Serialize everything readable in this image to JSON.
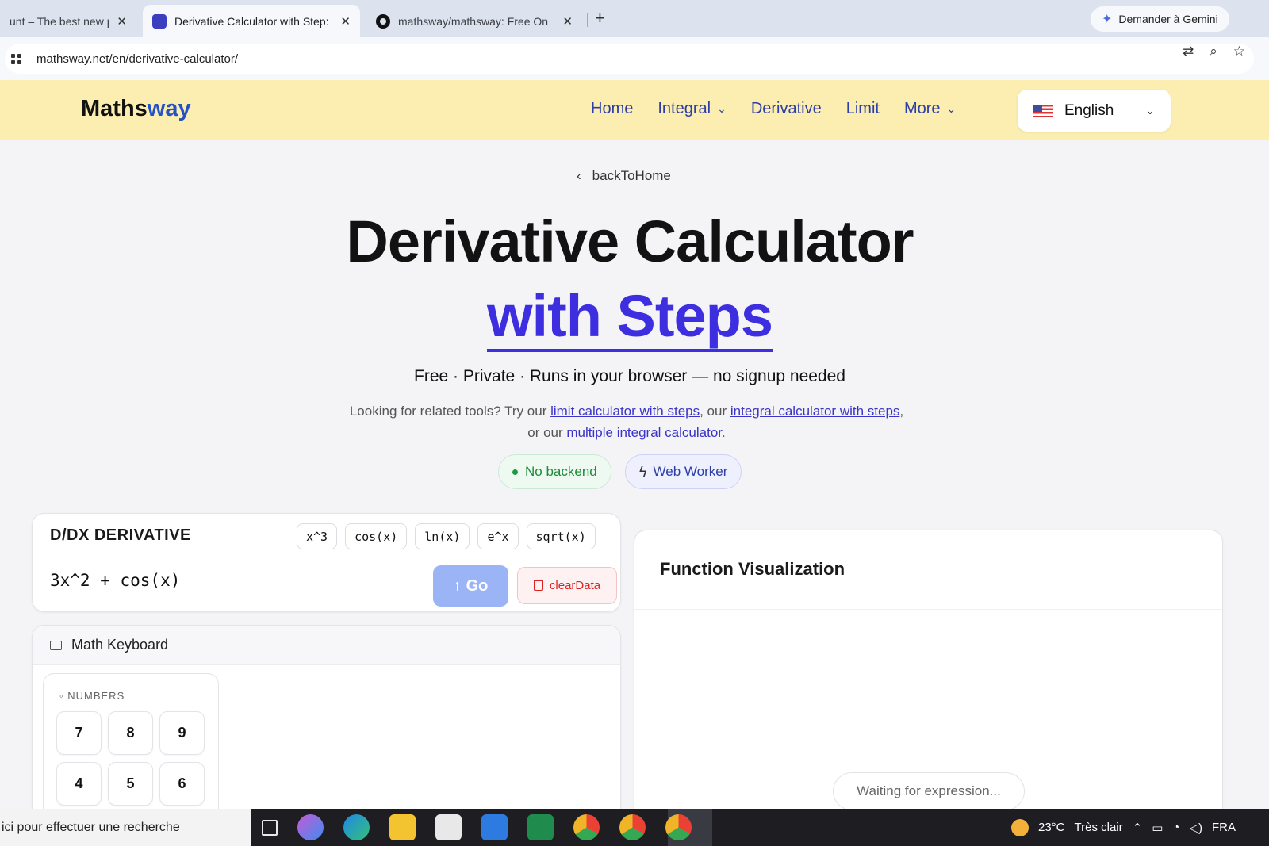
{
  "browser": {
    "tabs": [
      {
        "title": "unt – The best new p",
        "active": false
      },
      {
        "title": "Derivative Calculator with Step:",
        "active": true
      },
      {
        "title": "mathsway/mathsway: Free On",
        "active": false
      }
    ],
    "new_tab": "+",
    "close_glyph": "✕",
    "gemini_label": "Demander à Gemini",
    "url": "mathsway.net/en/derivative-calculator/",
    "address_icons": [
      "translate-icon",
      "zoom-icon",
      "bookmark-star-icon"
    ]
  },
  "site": {
    "logo_main": "Maths",
    "logo_accent": "way",
    "nav": {
      "home": "Home",
      "integral": "Integral",
      "derivative": "Derivative",
      "limit": "Limit",
      "more": "More"
    },
    "language": "English"
  },
  "hero": {
    "back_link": "backToHome",
    "title": "Derivative Calculator",
    "subtitle": "with Steps",
    "tagline": "Free · Private · Runs in your browser — no signup needed",
    "related_prefix": "Looking for related tools? Try our ",
    "related_link1": "limit calculator with steps",
    "related_mid1": ", our ",
    "related_link2": "integral calculator with steps",
    "related_mid2": ", or our ",
    "related_link3": "multiple integral calculator",
    "related_suffix": ".",
    "badge_backend": "No backend",
    "badge_worker": "Web Worker"
  },
  "calculator": {
    "title": "D/DX DERIVATIVE",
    "chips": [
      "x^3",
      "cos(x)",
      "ln(x)",
      "e^x",
      "sqrt(x)"
    ],
    "expression": "3x^2 + cos(x)",
    "go_label": "Go",
    "clear_label": "clearData"
  },
  "keyboard": {
    "title": "Math Keyboard",
    "section_label": "NUMBERS",
    "keys": [
      "7",
      "8",
      "9",
      "4",
      "5",
      "6"
    ]
  },
  "visualization": {
    "title": "Function Visualization",
    "status": "Waiting for expression..."
  },
  "taskbar": {
    "search_text": "ici pour effectuer une recherche",
    "temperature": "23°C",
    "weather": "Très clair",
    "language": "FRA",
    "app_colors": [
      "#e8e8e8",
      "#c45bd6",
      "#1e88e5",
      "#f4c430",
      "#e8e8e8",
      "#2d7be0",
      "#1f8b4c",
      "#f0b429",
      "#e94235",
      "#e94235"
    ]
  },
  "colors": {
    "header_bg": "#fbeeb0",
    "accent": "#3d2fe0",
    "nav_link": "#2c3ea8"
  }
}
